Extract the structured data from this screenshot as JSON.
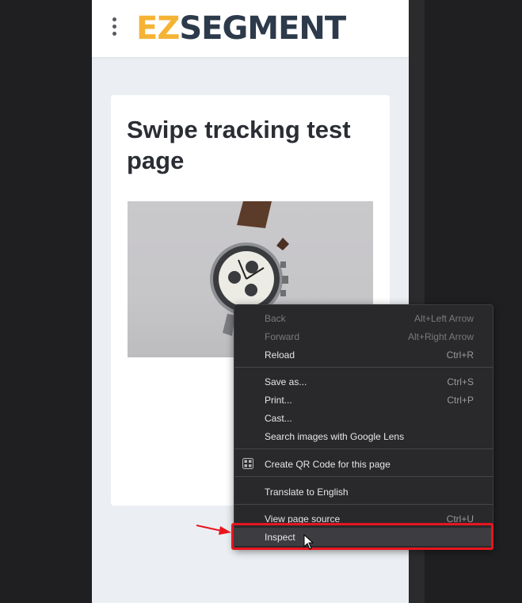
{
  "logo": {
    "part1": "EZ",
    "part2": "SEGMENT"
  },
  "card": {
    "title": "Swipe tracking test page"
  },
  "product_image": {
    "subject": "chronograph watch with brown leather strap"
  },
  "context_menu": {
    "group1": [
      {
        "label": "Back",
        "shortcut": "Alt+Left Arrow",
        "enabled": false
      },
      {
        "label": "Forward",
        "shortcut": "Alt+Right Arrow",
        "enabled": false
      },
      {
        "label": "Reload",
        "shortcut": "Ctrl+R",
        "enabled": true
      }
    ],
    "group2": [
      {
        "label": "Save as...",
        "shortcut": "Ctrl+S"
      },
      {
        "label": "Print...",
        "shortcut": "Ctrl+P"
      },
      {
        "label": "Cast...",
        "shortcut": ""
      },
      {
        "label": "Search images with Google Lens",
        "shortcut": ""
      }
    ],
    "group3": [
      {
        "label": "Create QR Code for this page",
        "icon": "qr-code-icon"
      }
    ],
    "group4": [
      {
        "label": "Translate to English"
      }
    ],
    "group5": [
      {
        "label": "View page source",
        "shortcut": "Ctrl+U"
      },
      {
        "label": "Inspect",
        "shortcut": "",
        "highlighted": true
      }
    ]
  },
  "colors": {
    "highlight": "#e8151f",
    "logo_accent": "#f5b335",
    "logo_dark": "#2c3a4b",
    "menu_bg": "#29292c"
  }
}
